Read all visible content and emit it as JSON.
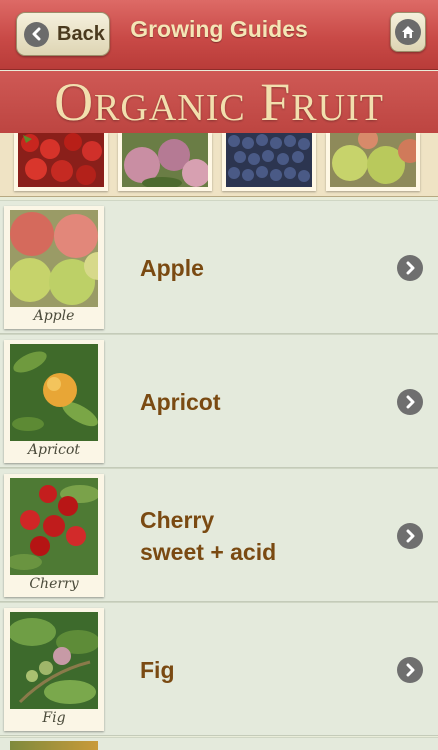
{
  "nav": {
    "back_label": "Back",
    "title": "Growing Guides",
    "back_icon": "chevron-left-icon",
    "home_icon": "home-icon"
  },
  "banner": {
    "title": "Organic Fruit"
  },
  "strip": {
    "tiles": [
      {
        "subject": "strawberries"
      },
      {
        "subject": "plums"
      },
      {
        "subject": "blueberries"
      },
      {
        "subject": "apples"
      }
    ]
  },
  "list": {
    "items": [
      {
        "label": "Apple",
        "caption": "Apple"
      },
      {
        "label": "Apricot",
        "caption": "Apricot"
      },
      {
        "label": "Cherry",
        "label2": "sweet + acid",
        "caption": "Cherry"
      },
      {
        "label": "Fig",
        "caption": "Fig"
      }
    ]
  },
  "colors": {
    "nav_red": "#c94a47",
    "banner_text": "#f2dfae",
    "label_brown": "#7a4a12",
    "row_bg": "#e4eadc"
  }
}
